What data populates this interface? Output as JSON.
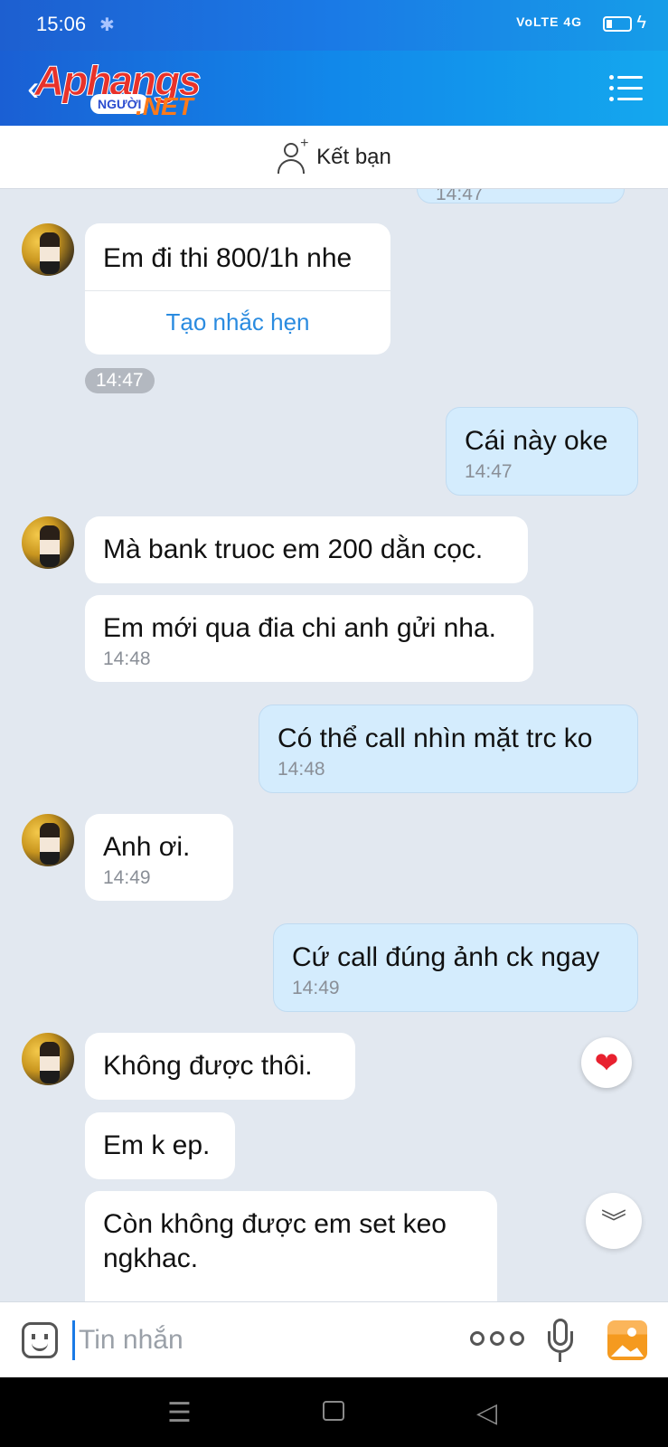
{
  "status_bar": {
    "time": "15:06",
    "network": "VoLTE 4G"
  },
  "header": {
    "logo_main": "Aphangs",
    "logo_tag": "NGƯỜI",
    "logo_suffix": ".NET"
  },
  "friend_bar": {
    "label": "Kết bạn"
  },
  "messages": [
    {
      "side": "out",
      "time": "14:47"
    },
    {
      "side": "in",
      "text": "Em đi thi 800/1h nhe",
      "action": "Tạo nhắc hẹn",
      "time": "14:47"
    },
    {
      "side": "out",
      "text": "Cái này oke",
      "time": "14:47"
    },
    {
      "side": "in",
      "text": "Mà bank truoc em 200 dằn cọc."
    },
    {
      "side": "in",
      "text": "Em mới qua đia chi anh gửi nha.",
      "time": "14:48"
    },
    {
      "side": "out",
      "text": "Có thể call nhìn mặt trc ko",
      "time": "14:48"
    },
    {
      "side": "in",
      "text": "Anh ơi.",
      "time": "14:49"
    },
    {
      "side": "out",
      "text": "Cứ call đúng ảnh ck ngay",
      "time": "14:49"
    },
    {
      "side": "in",
      "text": "Không được thôi."
    },
    {
      "side": "in",
      "text": "Em k ep."
    },
    {
      "side": "in",
      "text": "Còn không được em set keo ngkhac."
    }
  ],
  "input": {
    "placeholder": "Tin nhắn"
  },
  "icons": {
    "reaction": "heart-icon",
    "scroll": "double-chevron-down-icon",
    "emoji": "emoji-icon",
    "more": "more-icon",
    "mic": "microphone-icon",
    "gallery": "gallery-icon"
  },
  "colors": {
    "header_start": "#1a5fd4",
    "header_end": "#14a8ee",
    "out_bubble": "#d4ecfd",
    "link": "#2a8be0",
    "heart": "#e8212f"
  }
}
